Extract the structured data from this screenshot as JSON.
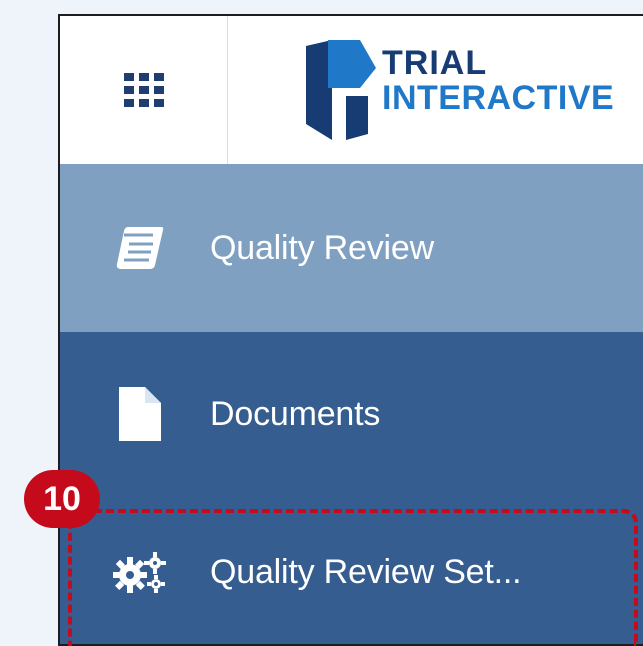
{
  "header": {
    "apps_icon": "apps-grid-icon",
    "logo": {
      "line1": "TRIAL",
      "line2": "INTERACTIVE",
      "brand_dark": "#173b73",
      "brand_light": "#1f78c8"
    }
  },
  "sidebar": {
    "items": [
      {
        "label": "Quality Review",
        "icon": "book-icon",
        "active": true
      },
      {
        "label": "Documents",
        "icon": "document-icon",
        "active": false
      },
      {
        "label": "Quality Review Set...",
        "icon": "gears-icon",
        "active": false
      }
    ],
    "colors": {
      "background": "#355d8f",
      "active_background": "#7fa0c1",
      "text": "#ffffff"
    }
  },
  "annotation": {
    "step_number": "10",
    "color": "#c50b1b"
  }
}
